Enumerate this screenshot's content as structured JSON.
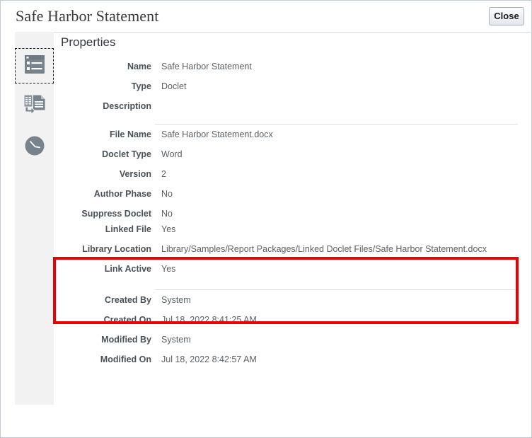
{
  "window": {
    "title": "Safe Harbor Statement",
    "close_label": "Close"
  },
  "sidebar": {
    "items": [
      {
        "icon": "properties-list-icon",
        "name": "properties",
        "selected": true
      },
      {
        "icon": "document-transfer-icon",
        "name": "transfer",
        "selected": false
      },
      {
        "icon": "clock-history-icon",
        "name": "history",
        "selected": false
      }
    ]
  },
  "panel": {
    "title": "Properties",
    "groups": [
      {
        "id": "identity",
        "fields": [
          {
            "label": "Name",
            "value": "Safe Harbor Statement"
          },
          {
            "label": "Type",
            "value": "Doclet"
          },
          {
            "label": "Description",
            "value": ""
          }
        ]
      },
      {
        "id": "file",
        "fields": [
          {
            "label": "File Name",
            "value": "Safe Harbor Statement.docx"
          },
          {
            "label": "Doclet Type",
            "value": "Word"
          },
          {
            "label": "Version",
            "value": "2"
          },
          {
            "label": "Author Phase",
            "value": "No"
          },
          {
            "label": "Suppress Doclet",
            "value": "No"
          }
        ]
      },
      {
        "id": "link",
        "fields": [
          {
            "label": "Linked File",
            "value": "Yes"
          },
          {
            "label": "Library Location",
            "value": "Library/Samples/Report Packages/Linked Doclet Files/Safe Harbor Statement.docx"
          },
          {
            "label": "Link Active",
            "value": "Yes"
          }
        ]
      },
      {
        "id": "audit",
        "fields": [
          {
            "label": "Created By",
            "value": "System"
          },
          {
            "label": "Created On",
            "value": "Jul 18, 2022 8:41:25 AM"
          },
          {
            "label": "Modified By",
            "value": "System"
          },
          {
            "label": "Modified On",
            "value": "Jul 18, 2022 8:42:57 AM"
          }
        ]
      }
    ]
  },
  "annotation": {
    "highlight_color": "#ee0000",
    "highlights": [
      "Linked File",
      "Library Location",
      "Link Active"
    ]
  },
  "colors": {
    "label": "#4a5259",
    "value": "#5a6268",
    "icon": "#77838c",
    "border": "#c3ccd4",
    "rail_bg": "#f2f2f2"
  }
}
